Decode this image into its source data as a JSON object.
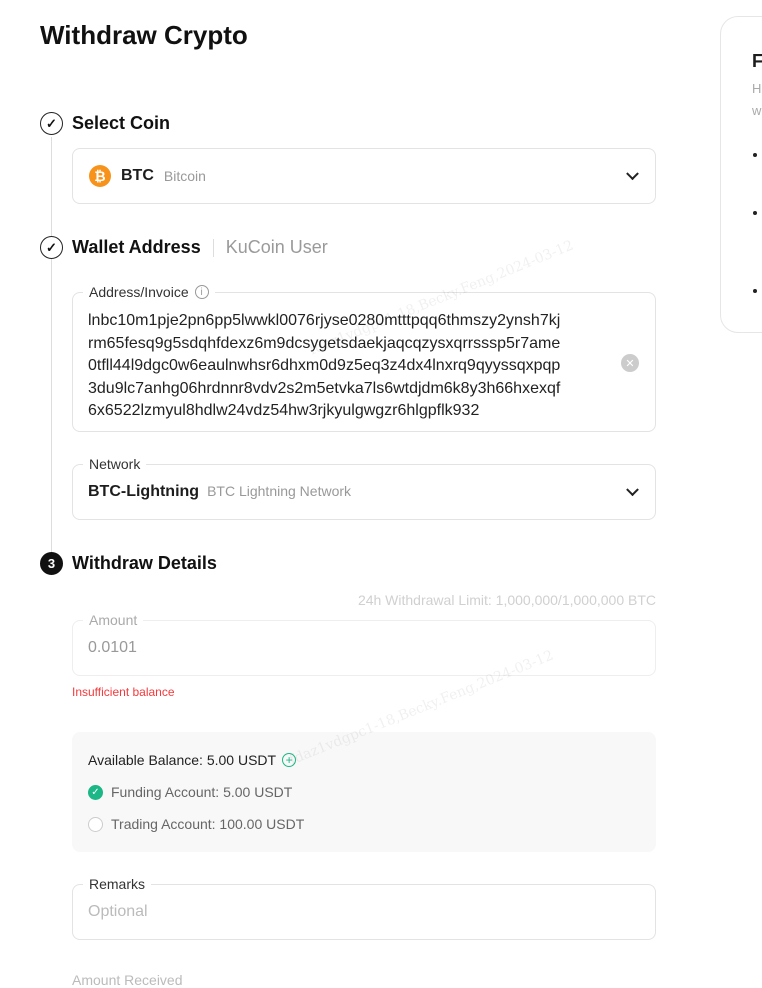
{
  "page_title": "Withdraw Crypto",
  "steps": {
    "select_coin": {
      "label": "Select Coin",
      "state": "completed"
    },
    "wallet_address": {
      "label": "Wallet Address",
      "alt_tab": "KuCoin User",
      "state": "completed"
    },
    "withdraw_details": {
      "label": "Withdraw Details",
      "number": "3"
    }
  },
  "coin": {
    "symbol": "BTC",
    "name": "Bitcoin",
    "icon": "bitcoin-icon",
    "icon_glyph": "₿",
    "color": "#f7931a"
  },
  "address": {
    "label": "Address/Invoice",
    "lines": [
      "lnbc10m1pje2pn6pp5lwwkl0076rjyse0280mtttpqq6thmszy2ynsh7kj",
      "rm65fesq9g5sdqhfdexz6m9dcsygetsdaekjaqcqzysxqrrsssp5r7ame",
      "0tfll44l9dgc0w6eaulnwhsr6dhxm0d9z5eq3z4dx4lnxrq9qyyssqxpqp",
      "3du9lc7anhg06hrdnnr8vdv2s2m5etvka7ls6wtdjdm6k8y3h66hxexqf",
      "6x6522lzmyul8hdlw24vdz54hw3rjkyulgwgzr6hlgpflk932"
    ]
  },
  "network": {
    "label": "Network",
    "value": "BTC-Lightning",
    "description": "BTC Lightning Network"
  },
  "withdraw_limit": "24h Withdrawal Limit: 1,000,000/1,000,000 BTC",
  "amount": {
    "label": "Amount",
    "value": "0.0101",
    "error": "Insufficient balance"
  },
  "balance": {
    "available": "Available Balance: 5.00 USDT",
    "accounts": [
      {
        "label": "Funding Account: 5.00 USDT",
        "selected": true
      },
      {
        "label": "Trading Account: 100.00 USDT",
        "selected": false
      }
    ],
    "accent": "#1cb787"
  },
  "remarks": {
    "label": "Remarks",
    "placeholder": "Optional"
  },
  "amount_received_label": "Amount Received",
  "side_panel": {
    "title": "F",
    "line1": "H",
    "line2": "w"
  },
  "watermark": "fdaz1vdgpc1-18,Becky.Feng,2024-03-12",
  "error_color": "#f5393b"
}
